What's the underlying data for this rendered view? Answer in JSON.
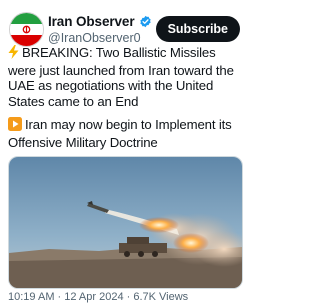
{
  "account": {
    "name": "Iran Observer",
    "handle": "@IranObserver0",
    "verified": true,
    "avatar_icon": "iran-flag-icon"
  },
  "subscribe_label": "Subscribe",
  "post": {
    "breaking_icon": "lightning-icon",
    "breaking_text": "BREAKING: Two Ballistic Missiles were just launched from Iran toward the UAE as negotiations with the United States came to an End",
    "play_icon": "play-button-icon",
    "second_text": "Iran may now begin to Implement its Offensive Military Doctrine",
    "media_alt": "missile launch photo"
  },
  "footer": {
    "timestamp": "10:19 AM · 12 Apr 2024 · 6.7K Views"
  },
  "colors": {
    "verified": "#1d9bf0",
    "subscribe_bg": "#0f1419",
    "text": "#0f1419",
    "muted": "#536471"
  }
}
